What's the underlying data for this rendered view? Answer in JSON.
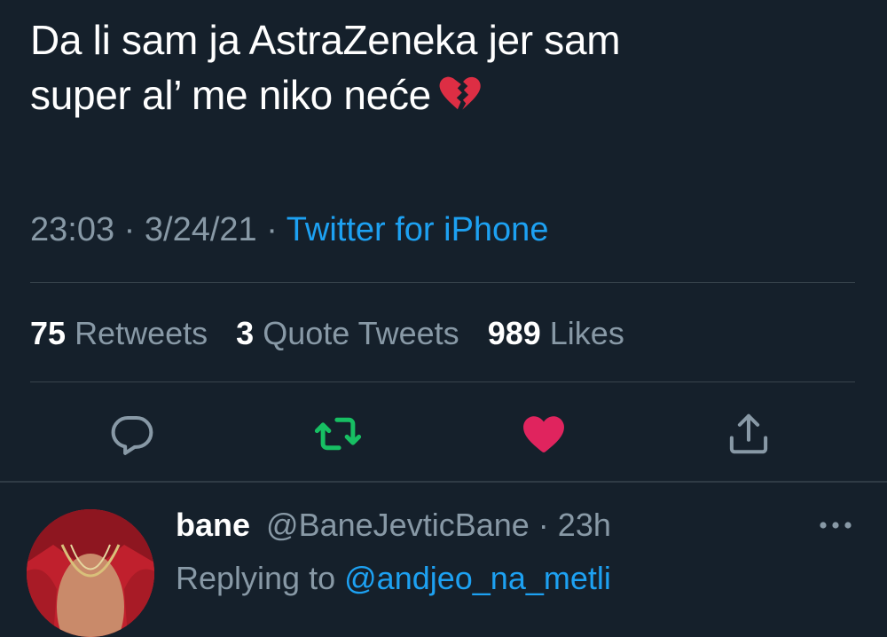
{
  "tweet": {
    "text_line1": "Da li sam ja AstraZeneka jer sam",
    "text_line2": "super al’ me niko neće",
    "emoji": "broken-heart-icon",
    "time": "23:03",
    "date": "3/24/21",
    "separator": "·",
    "source": "Twitter for iPhone"
  },
  "stats": {
    "retweets_count": "75",
    "retweets_label": "Retweets",
    "quotes_count": "3",
    "quotes_label": "Quote Tweets",
    "likes_count": "989",
    "likes_label": "Likes"
  },
  "actions": {
    "reply_icon": "reply-icon",
    "retweet_icon": "retweet-icon",
    "like_icon": "like-icon",
    "share_icon": "share-icon"
  },
  "reply": {
    "name": "bane",
    "handle": "@BaneJevticBane",
    "separator": "·",
    "time": "23h",
    "replying_to_label": "Replying to",
    "replying_to_handle": "@andjeo_na_metli",
    "more_icon": "more-icon"
  },
  "colors": {
    "background": "#15202b",
    "text_primary": "#ffffff",
    "text_secondary": "#8899a6",
    "link": "#1da1f2",
    "retweet_active": "#17bf63",
    "like_active": "#e0245e",
    "divider": "#38444d"
  }
}
